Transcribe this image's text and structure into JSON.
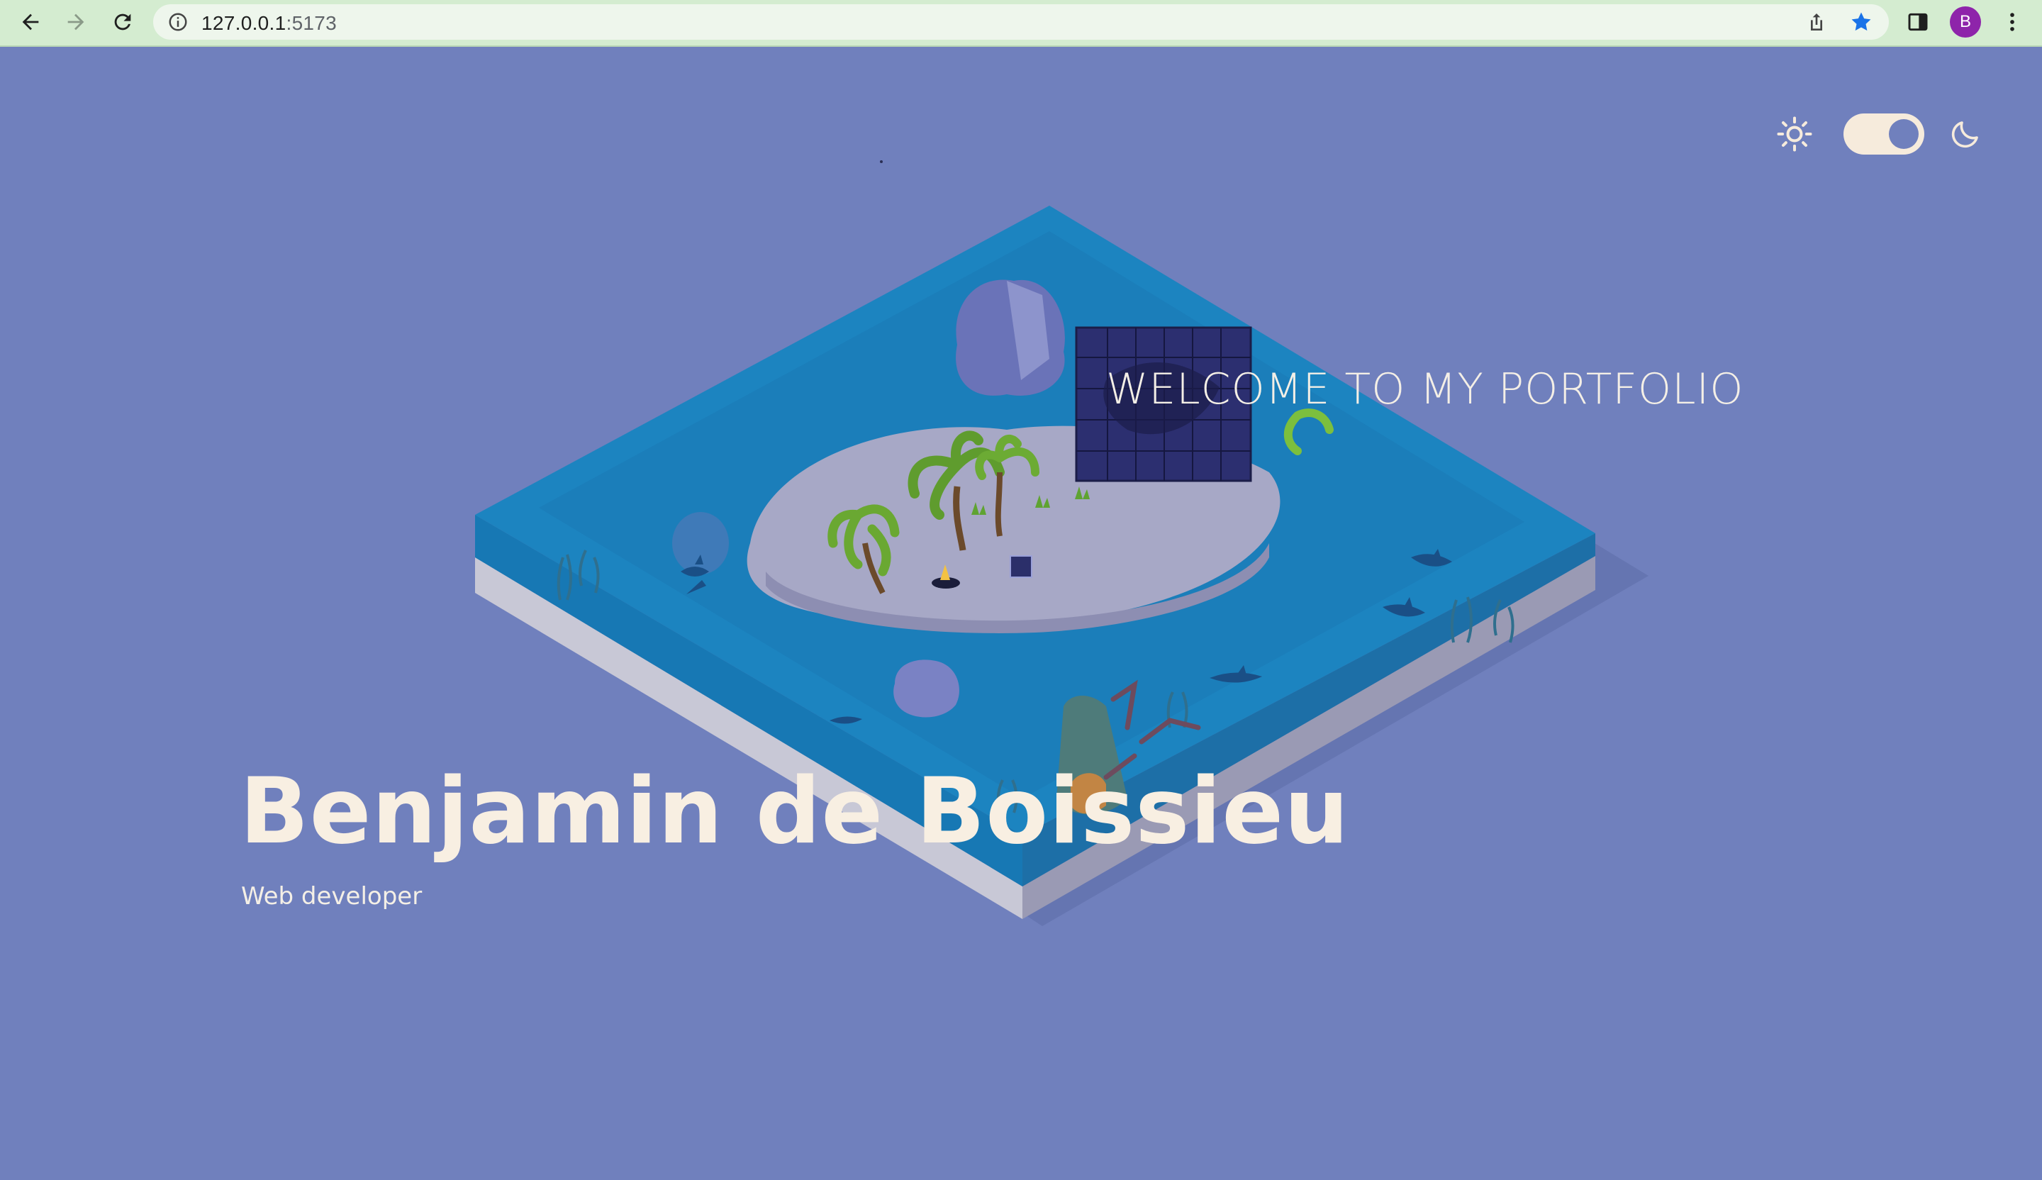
{
  "browser": {
    "url_host": "127.0.0.1",
    "url_port": ":5173",
    "profile_initial": "B",
    "icons": {
      "back": "arrow-left-icon",
      "forward": "arrow-right-icon",
      "reload": "reload-icon",
      "site_info": "info-icon",
      "share": "share-icon",
      "bookmark": "star-icon",
      "side_panel": "side-panel-icon",
      "menu": "kebab-menu-icon"
    }
  },
  "page": {
    "welcome_text": "WELCOME TO MY PORTFOLIO",
    "name": "Benjamin de Boissieu",
    "role": "Web developer",
    "theme_toggle": {
      "left_icon": "sun-icon",
      "right_icon": "moon-icon",
      "state": "dark"
    }
  },
  "colors": {
    "background": "#7080bd",
    "chrome": "#d4ecd0",
    "text_light": "#f8efe2",
    "water": "#1b88c4",
    "sand": "#a6a6c4",
    "avatar": "#8e24aa",
    "bookmark_star": "#1a73e8"
  }
}
